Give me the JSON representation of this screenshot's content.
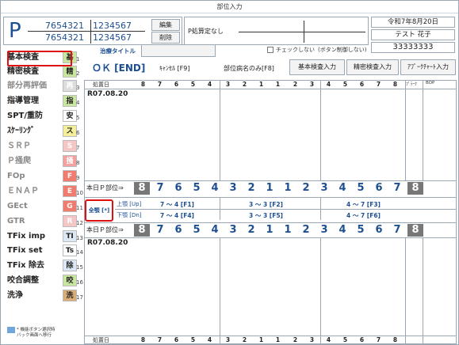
{
  "window": {
    "title": "部位入力"
  },
  "patient": {
    "big_letter": "P",
    "id_top_left": "7654321",
    "id_top_right": "1234567",
    "id_bottom_left": "7654321",
    "id_bottom_right": "1234567",
    "edit_label": "編集",
    "delete_label": "削除",
    "p_calc_label": "P処算定なし",
    "date": "令和7年8月20日",
    "name": "テスト 花子",
    "patient_number": "33333333",
    "check_label": "チェックしない",
    "button_disabled_note": "(ボタン制御しない)"
  },
  "treatment_title_label": "治療タイトル",
  "toolbar": {
    "ok_label": "ＯＫ [END]",
    "cancel_label": "ｷｬﾝｾﾙ [F9]",
    "part_only_label": "部位病名のみ[F8]",
    "basic_exam_label": "基本検査入力",
    "precise_exam_label": "精密検査入力",
    "apache_label": "ｱﾌﾟｰｸﾁｬｰﾄ入力"
  },
  "sidebar": {
    "items": [
      {
        "label": "基本検査",
        "tag": "基",
        "num": "1",
        "color": "#c8e6a0"
      },
      {
        "label": "精密検査",
        "tag": "精",
        "num": "2",
        "color": "#c8e6a0"
      },
      {
        "label": "部分再評価",
        "tag": "再",
        "num": "3",
        "color": "#dcdcdc"
      },
      {
        "label": "指導管理",
        "tag": "指",
        "num": "4",
        "color": "#c8e6a0"
      },
      {
        "label": "SPT/重防",
        "tag": "安",
        "num": "5",
        "color": "#ffffff"
      },
      {
        "label": "ｽｹｰﾘﾝｸﾞ",
        "tag": "ス",
        "num": "6",
        "color": "#f3ef9a"
      },
      {
        "label": "ＳＲＰ",
        "tag": "S",
        "num": "7",
        "color": "#f4c6c6"
      },
      {
        "label": "Ｐ掻爬",
        "tag": "掻",
        "num": "8",
        "color": "#f4a0a0"
      },
      {
        "label": "FOp",
        "tag": "F",
        "num": "9",
        "color": "#f07c70"
      },
      {
        "label": "ＥＮＡＰ",
        "tag": "E",
        "num": "10",
        "color": "#f07c70"
      },
      {
        "label": "GEct",
        "tag": "G",
        "num": "11",
        "color": "#f07c70"
      },
      {
        "label": "GTR",
        "tag": "R",
        "num": "12",
        "color": "#f4c6c6"
      },
      {
        "label": "TFix imp",
        "tag": "TI",
        "num": "13",
        "color": "#dde8f5"
      },
      {
        "label": "TFix set",
        "tag": "Ts",
        "num": "14",
        "color": "#ffffff"
      },
      {
        "label": "TFix 除去",
        "tag": "除",
        "num": "15",
        "color": "#dde8f5"
      },
      {
        "label": "咬合調整",
        "tag": "咬",
        "num": "16",
        "color": "#c8e6a0"
      },
      {
        "label": "洗浄",
        "tag": "洗",
        "num": "17",
        "color": "#d8ad78"
      }
    ],
    "legend_note_line1": "* 機能ボタン選択時",
    "legend_note_line2": "バック画面へ移行"
  },
  "chart": {
    "tooth_header_label": "処置日",
    "tooth_numbers_upper": [
      "8",
      "7",
      "6",
      "5",
      "4",
      "3",
      "2",
      "1",
      "1",
      "2",
      "3",
      "4",
      "5",
      "6",
      "7",
      "8"
    ],
    "plaque_label": "ﾌﾟﾗｰｸ",
    "bop_label": "BOP",
    "upper_date": "R07.08.20",
    "today_label": "本日Ｐ部位⇒",
    "big_row": [
      "8",
      "7",
      "6",
      "5",
      "4",
      "3",
      "2",
      "1",
      "1",
      "2",
      "3",
      "4",
      "5",
      "6",
      "7",
      "8"
    ],
    "all_teeth_label": "全顎 [*]",
    "upper_row": {
      "label": "上顎 [Up]",
      "q1": "7 ～ 4 [F1]",
      "q2": "3 ～ 3 [F2]",
      "q3": "4 ～ 7 [F3]"
    },
    "lower_row": {
      "label": "下顎 [Dn]",
      "q1": "7 ～ 4 [F4]",
      "q2": "3 ～ 3 [F5]",
      "q3": "4 ～ 7 [F6]"
    },
    "lower_date": "R07.08.20",
    "bottom_header_label": "処置日"
  }
}
